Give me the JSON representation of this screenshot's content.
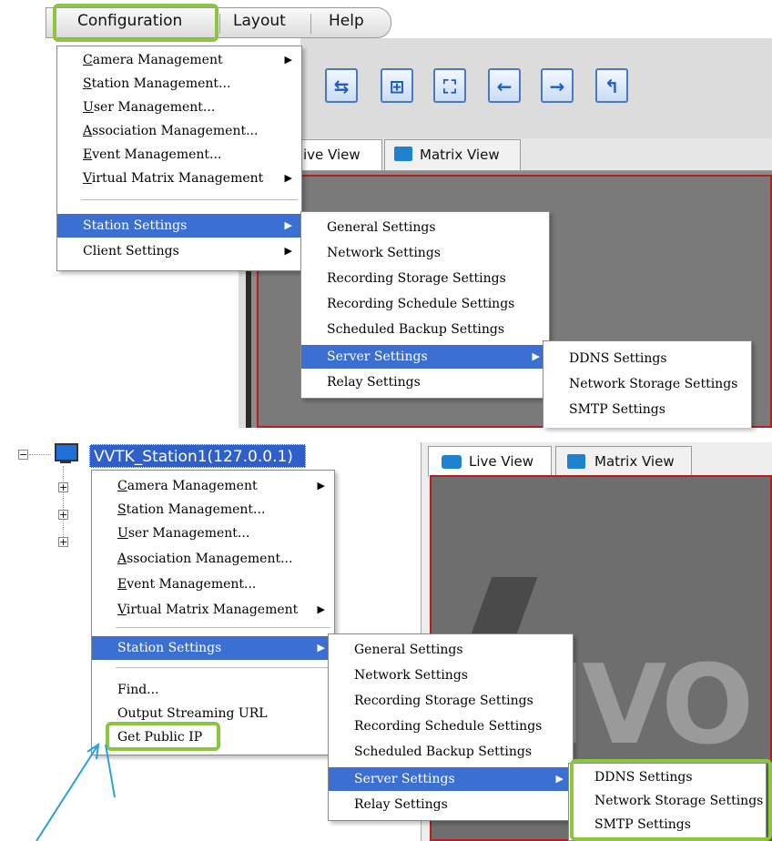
{
  "menubar": {
    "items": [
      "Configuration",
      "Layout",
      "Help"
    ]
  },
  "config_menu": {
    "items": [
      {
        "label": "Camera Management",
        "u": "C",
        "rest": "amera Management",
        "submenu": true
      },
      {
        "label": "Station Management...",
        "u": "S",
        "rest": "tation Management..."
      },
      {
        "label": "User Management...",
        "u": "U",
        "rest": "ser Management..."
      },
      {
        "label": "Association Management...",
        "u": "A",
        "rest": "ssociation Management..."
      },
      {
        "label": "Event Management...",
        "u": "E",
        "rest": "vent Management..."
      },
      {
        "label": "Virtual Matrix Management",
        "u": "V",
        "rest": "irtual Matrix Management",
        "submenu": true
      }
    ],
    "station_settings": "Station Settings",
    "client_settings": "Client Settings"
  },
  "context_menu": {
    "station_label": "VVTK_Station1(127.0.0.1)",
    "find": "Find...",
    "output_streaming_url": "Output Streaming URL",
    "get_public_ip": "Get Public IP"
  },
  "station_settings_menu": {
    "items": [
      "General Settings",
      "Network Settings",
      "Recording Storage Settings",
      "Recording Schedule Settings",
      "Scheduled Backup Settings",
      "Server Settings",
      "Relay Settings"
    ]
  },
  "server_settings_menu": {
    "items": [
      "DDNS Settings",
      "Network Storage Settings",
      "SMTP Settings"
    ]
  },
  "tabs": {
    "live_view": "Live View",
    "live_view_partial": "ive View",
    "matrix_view": "Matrix View"
  },
  "logo": "VIVO",
  "colors": {
    "highlight_green": "#8cc63e",
    "selection_blue": "#3b6fd1",
    "arrow_blue": "#2aa0d8"
  }
}
